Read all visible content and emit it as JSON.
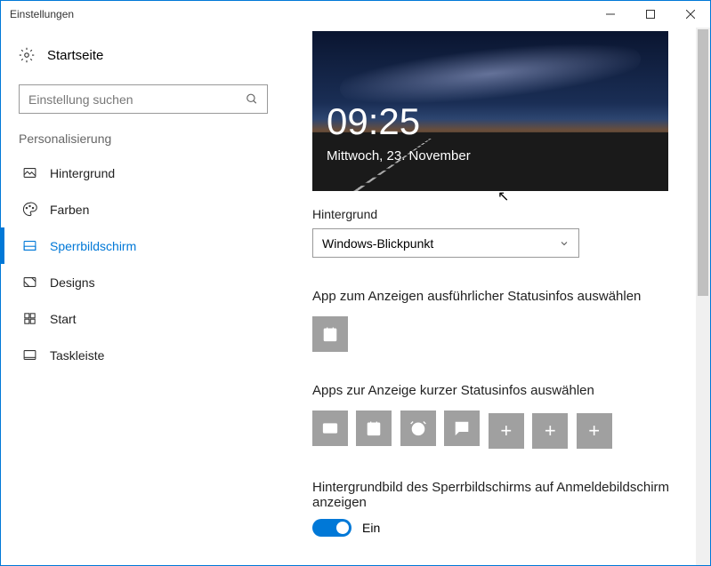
{
  "window": {
    "title": "Einstellungen"
  },
  "sidebar": {
    "home": "Startseite",
    "search_placeholder": "Einstellung suchen",
    "section": "Personalisierung",
    "items": [
      {
        "label": "Hintergrund",
        "icon": "image-icon"
      },
      {
        "label": "Farben",
        "icon": "palette-icon"
      },
      {
        "label": "Sperrbildschirm",
        "icon": "lockscreen-icon"
      },
      {
        "label": "Designs",
        "icon": "themes-icon"
      },
      {
        "label": "Start",
        "icon": "start-icon"
      },
      {
        "label": "Taskleiste",
        "icon": "taskbar-icon"
      }
    ],
    "active_index": 2
  },
  "main": {
    "preview": {
      "time": "09:25",
      "date": "Mittwoch, 23. November"
    },
    "background_label": "Hintergrund",
    "background_value": "Windows-Blickpunkt",
    "detailed_status_label": "App zum Anzeigen ausführlicher Statusinfos auswählen",
    "detailed_status_app": "calendar",
    "quick_status_label": "Apps zur Anzeige kurzer Statusinfos auswählen",
    "quick_status_apps": [
      "mail",
      "calendar",
      "alarm",
      "messaging",
      "add",
      "add",
      "add"
    ],
    "signin_bg_label": "Hintergrundbild des Sperrbildschirms auf Anmeldebildschirm anzeigen",
    "signin_bg_toggle": {
      "on": true,
      "text": "Ein"
    }
  }
}
